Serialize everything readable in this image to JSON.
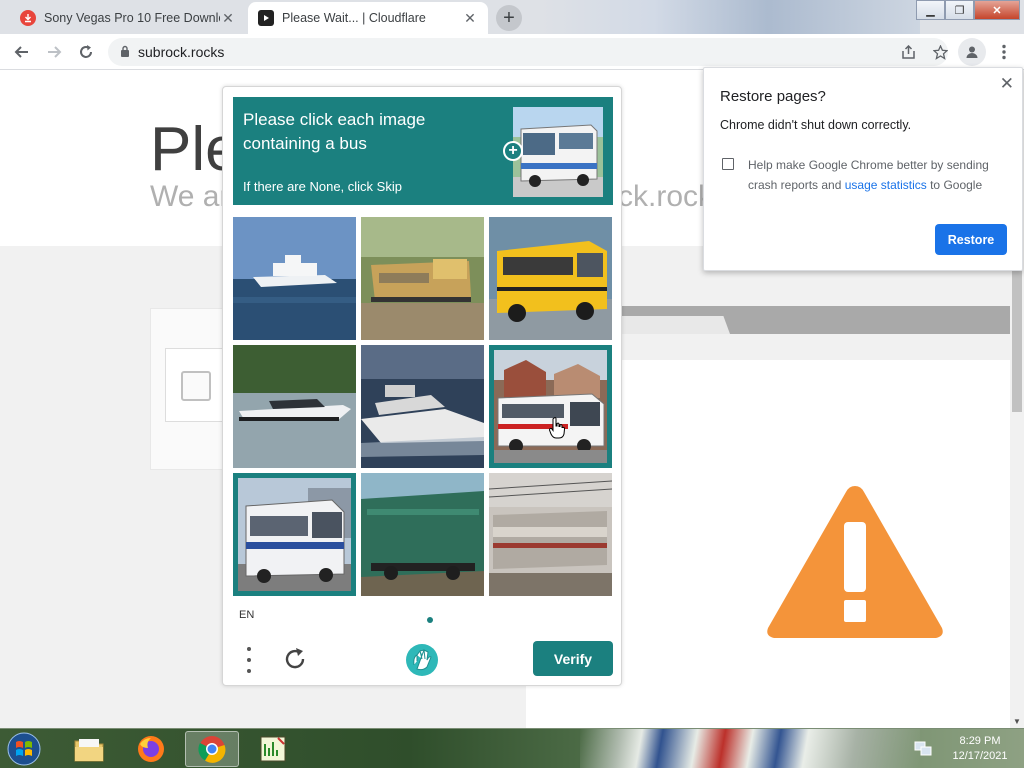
{
  "browser": {
    "tabs": [
      {
        "title": "Sony Vegas Pro 10 Free Downlo",
        "favicon": "download-icon",
        "active": false
      },
      {
        "title": "Please Wait... | Cloudflare",
        "favicon": "youtube-icon",
        "active": true
      }
    ],
    "url": "subrock.rocks",
    "colors": {
      "chrome_blue": "#1a73e8",
      "tab_strip": "#dee1e6"
    }
  },
  "page": {
    "title_partial": "Ple",
    "subtitle_left": "We ar",
    "subtitle_right": "ck.rock"
  },
  "captcha": {
    "prompt": "Please click each image containing a bus",
    "hint": "If there are None, click Skip",
    "language": "EN",
    "verify_label": "Verify",
    "accent_color": "#1b807f",
    "cells": [
      {
        "subject": "ferry",
        "selected": false
      },
      {
        "subject": "train",
        "selected": false
      },
      {
        "subject": "school-bus",
        "selected": false
      },
      {
        "subject": "speedboat",
        "selected": false
      },
      {
        "subject": "yacht",
        "selected": false
      },
      {
        "subject": "bus",
        "selected": true
      },
      {
        "subject": "bus",
        "selected": true
      },
      {
        "subject": "locomotive",
        "selected": false
      },
      {
        "subject": "train",
        "selected": false
      }
    ]
  },
  "restore_dialog": {
    "title": "Restore pages?",
    "message": "Chrome didn't shut down correctly.",
    "checkbox_text_before": "Help make Google Chrome better by sending crash reports and ",
    "checkbox_link": "usage statistics",
    "checkbox_text_after": " to Google",
    "checkbox_checked": false,
    "button_label": "Restore"
  },
  "taskbar": {
    "items": [
      "explorer-icon",
      "firefox-icon",
      "chrome-icon",
      "editor-icon"
    ],
    "active_item": "chrome-icon",
    "time": "8:29 PM",
    "date": "12/17/2021"
  }
}
